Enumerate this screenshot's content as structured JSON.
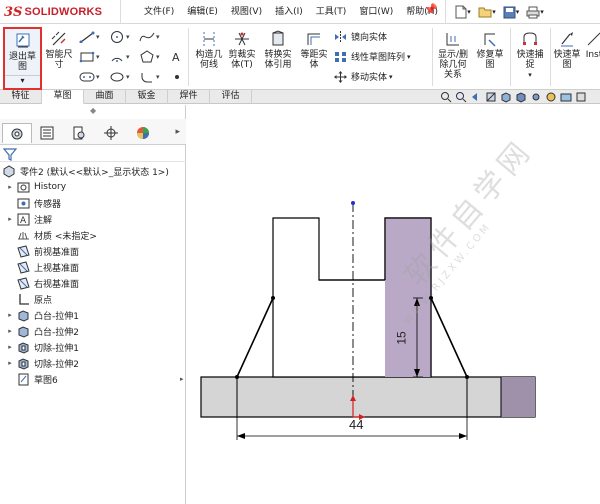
{
  "app": {
    "brand_prefix": "3S",
    "brand_name": "SOLIDWORKS"
  },
  "menu": [
    "文件(F)",
    "编辑(E)",
    "视图(V)",
    "插入(I)",
    "工具(T)",
    "窗口(W)",
    "帮助(H)"
  ],
  "ribbon": {
    "exit_sketch": "退出草\n图",
    "smart_dim": "智能尺\n寸",
    "trim_entities": "剪裁实\n体(T)",
    "construction_geometry": "构造几\n何线",
    "convert_entities": "转换实\n体引用",
    "offset_entities": "等距实\n体",
    "mirror_entities": "镜向实体",
    "linear_pattern": "线性草图阵列",
    "move_entities": "移动实体",
    "display_relations": "显示/删\n除几何\n关系",
    "repair_sketch": "修复草\n图",
    "quick_snaps": "快速捕\n捉",
    "rapid_sketch": "快速草\n图",
    "instant2d": "Inst"
  },
  "tabs": [
    "特征",
    "草图",
    "曲面",
    "钣金",
    "焊件",
    "评估"
  ],
  "active_tab": "草图",
  "tree": {
    "part": "零件2 (默认<<默认>_显示状态 1>)",
    "items": [
      {
        "label": "History",
        "expandable": true,
        "icon": "history-icon"
      },
      {
        "label": "传感器",
        "expandable": false,
        "icon": "sensor-icon"
      },
      {
        "label": "注解",
        "expandable": true,
        "icon": "annotation-icon"
      },
      {
        "label": "材质 <未指定>",
        "expandable": false,
        "icon": "material-icon"
      },
      {
        "label": "前视基准面",
        "expandable": false,
        "icon": "plane-icon"
      },
      {
        "label": "上视基准面",
        "expandable": false,
        "icon": "plane-icon"
      },
      {
        "label": "右视基准面",
        "expandable": false,
        "icon": "plane-icon"
      },
      {
        "label": "原点",
        "expandable": false,
        "icon": "origin-icon"
      },
      {
        "label": "凸台-拉伸1",
        "expandable": true,
        "icon": "boss-extrude-icon"
      },
      {
        "label": "凸台-拉伸2",
        "expandable": true,
        "icon": "boss-extrude-icon"
      },
      {
        "label": "切除-拉伸1",
        "expandable": true,
        "icon": "cut-extrude-icon"
      },
      {
        "label": "切除-拉伸2",
        "expandable": true,
        "icon": "cut-extrude-icon"
      },
      {
        "label": "草图6",
        "expandable": false,
        "icon": "sketch-icon"
      }
    ]
  },
  "dimensions": {
    "vertical": "15",
    "horizontal": "44"
  },
  "watermark": {
    "text": "软件自学网",
    "url": "WWW.RJZXW.COM"
  },
  "colors": {
    "highlight_box": "#e03030",
    "accent": "#3c6fb5",
    "cylinder": "#b9a9c7"
  }
}
